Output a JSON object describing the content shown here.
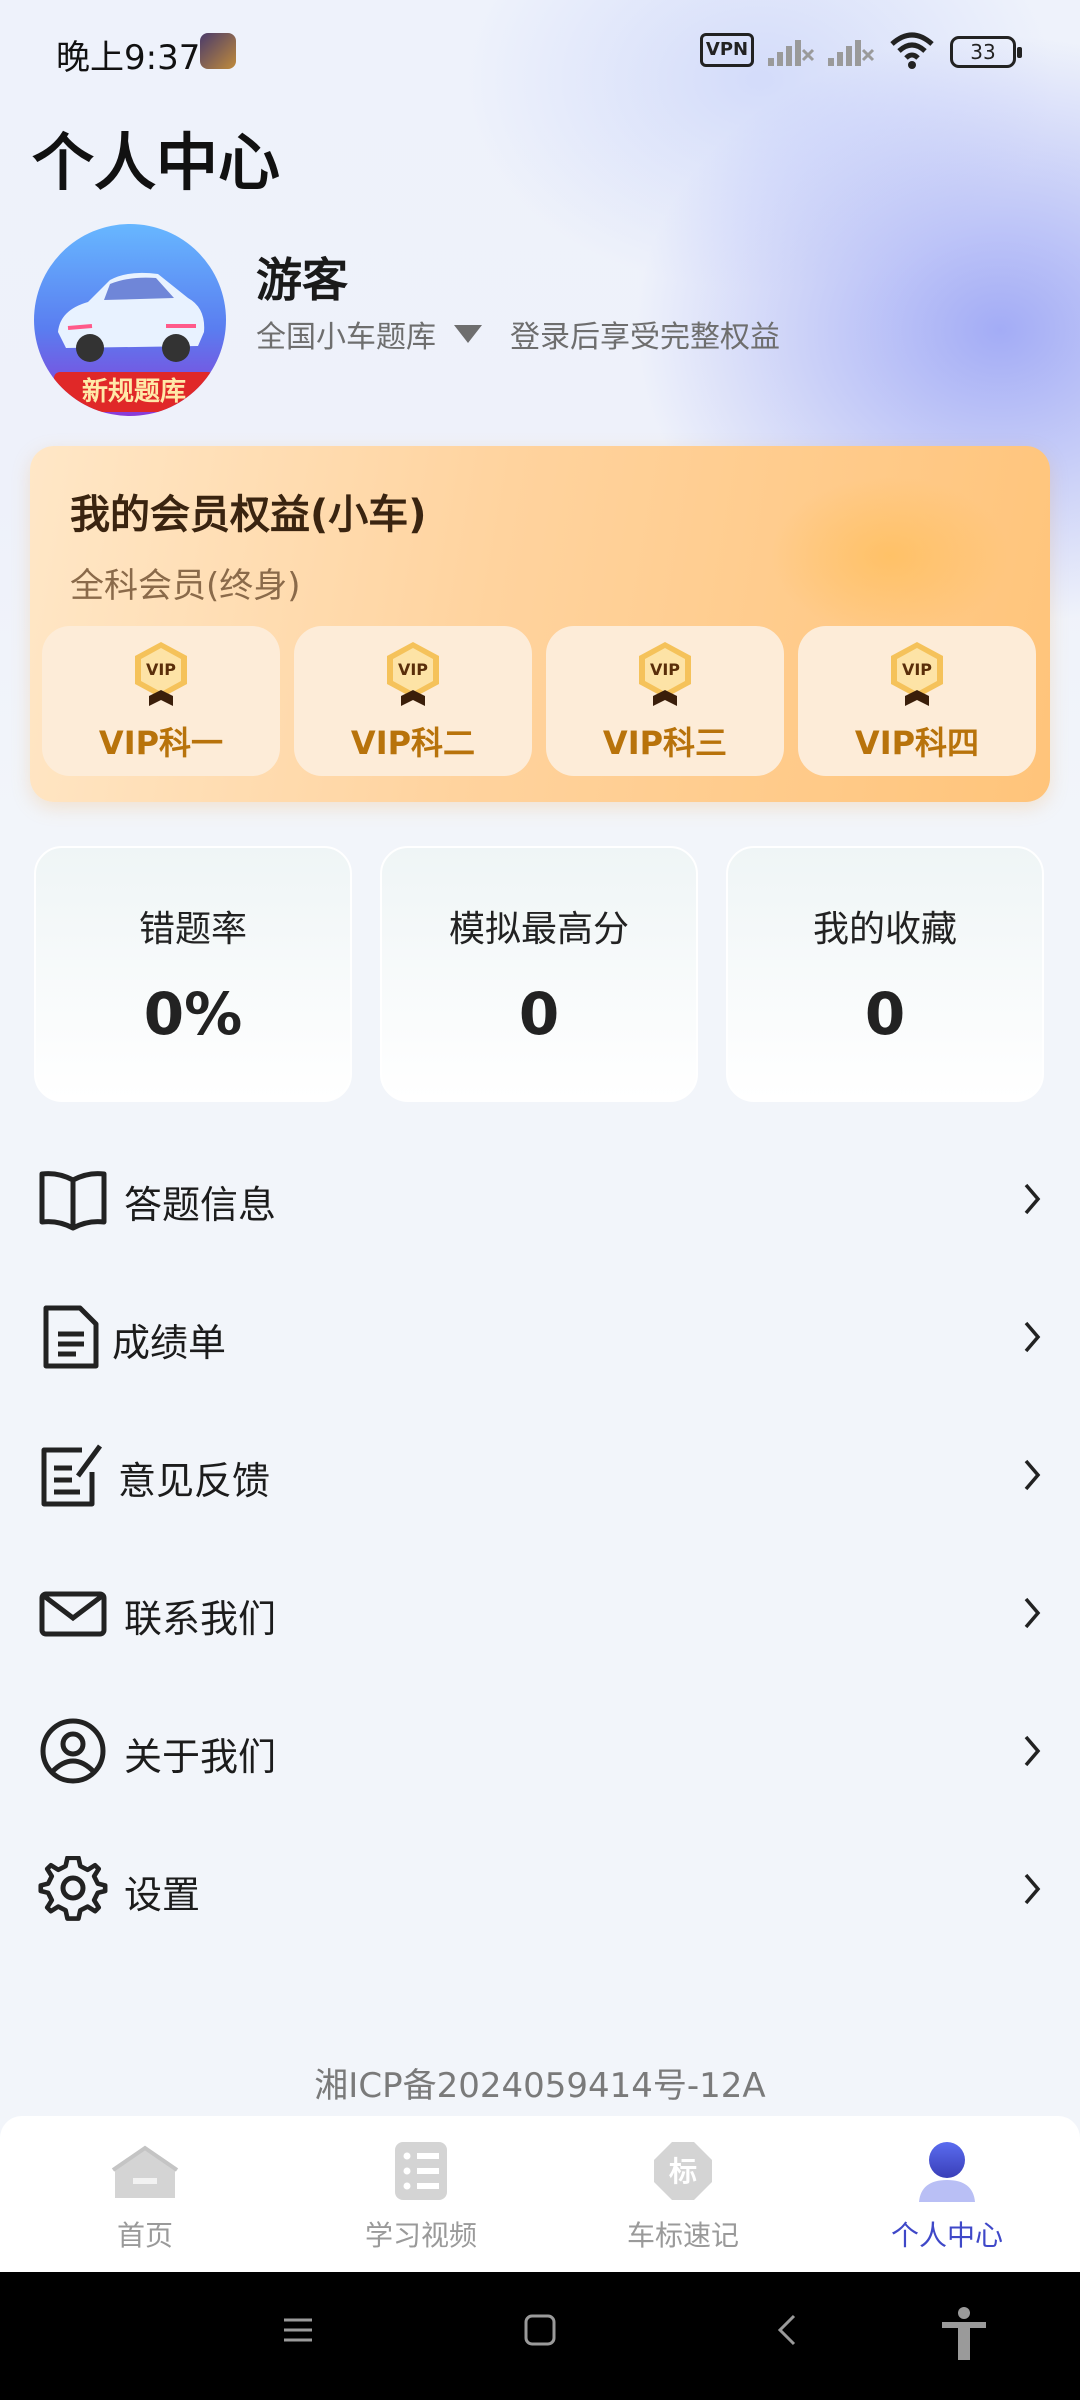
{
  "status_bar": {
    "time": "晚上9:37",
    "vpn": "VPN",
    "battery": "33"
  },
  "page": {
    "title": "个人中心"
  },
  "profile": {
    "name": "游客",
    "question_bank": "全国小车题库",
    "login_hint": "登录后享受完整权益",
    "avatar_tag": "新规题库"
  },
  "vip": {
    "title": "我的会员权益(小车)",
    "membership": "全科会员(终身)",
    "items": [
      {
        "icon": "VIP",
        "label": "VIP科一"
      },
      {
        "icon": "VIP",
        "label": "VIP科二"
      },
      {
        "icon": "VIP",
        "label": "VIP科三"
      },
      {
        "icon": "VIP",
        "label": "VIP科四"
      }
    ]
  },
  "stats": [
    {
      "label": "错题率",
      "value": "0%"
    },
    {
      "label": "模拟最高分",
      "value": "0"
    },
    {
      "label": "我的收藏",
      "value": "0"
    }
  ],
  "menu": [
    {
      "label": "答题信息",
      "icon": "book-icon"
    },
    {
      "label": "成绩单",
      "icon": "document-icon"
    },
    {
      "label": "意见反馈",
      "icon": "edit-note-icon"
    },
    {
      "label": "联系我们",
      "icon": "mail-icon"
    },
    {
      "label": "关于我们",
      "icon": "user-circle-icon"
    },
    {
      "label": "设置",
      "icon": "gear-icon"
    }
  ],
  "footer": {
    "icp": "湘ICP备2024059414号-12A"
  },
  "tabs": [
    {
      "label": "首页",
      "icon": "home-icon",
      "active": false,
      "glyph": ""
    },
    {
      "label": "学习视频",
      "icon": "video-list-icon",
      "active": false,
      "glyph": ""
    },
    {
      "label": "车标速记",
      "icon": "badge-icon",
      "active": false,
      "glyph": "标"
    },
    {
      "label": "个人中心",
      "icon": "person-icon",
      "active": true,
      "glyph": ""
    }
  ],
  "colors": {
    "accent": "#3f48c8",
    "vip_text": "#b8730b",
    "vip_card": "#ffd39e"
  }
}
